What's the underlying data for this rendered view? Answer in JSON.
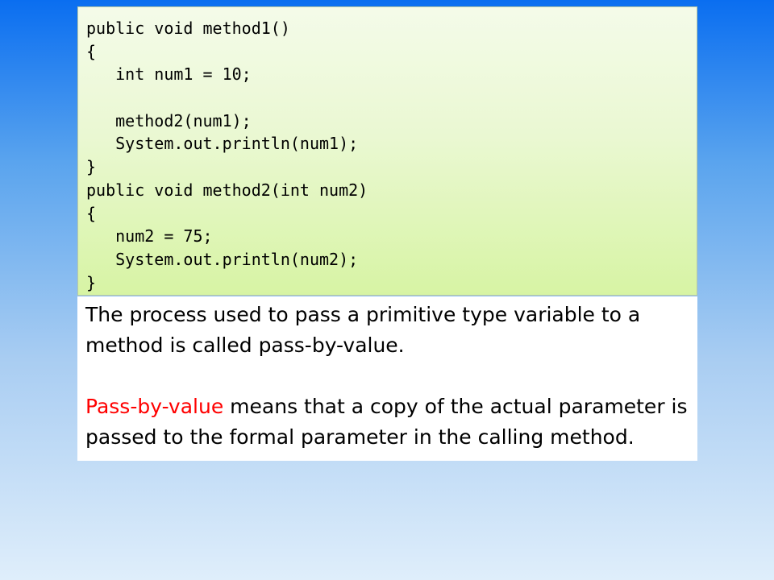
{
  "code": {
    "lines": [
      "public void method1()",
      "{",
      "   int num1 = 10;",
      "",
      "   method2(num1);",
      "   System.out.println(num1);",
      "}",
      "public void method2(int num2)",
      "{",
      "   num2 = 75;",
      "   System.out.println(num2);",
      "}"
    ]
  },
  "explanation": {
    "paragraph1": "The process used to pass a primitive type variable to a method is called pass-by-value.",
    "paragraph2_highlight": "Pass-by-value",
    "paragraph2_rest": " means that a copy of the actual parameter is passed to the formal parameter in the calling method.",
    "highlight_color": "#ff0000"
  }
}
